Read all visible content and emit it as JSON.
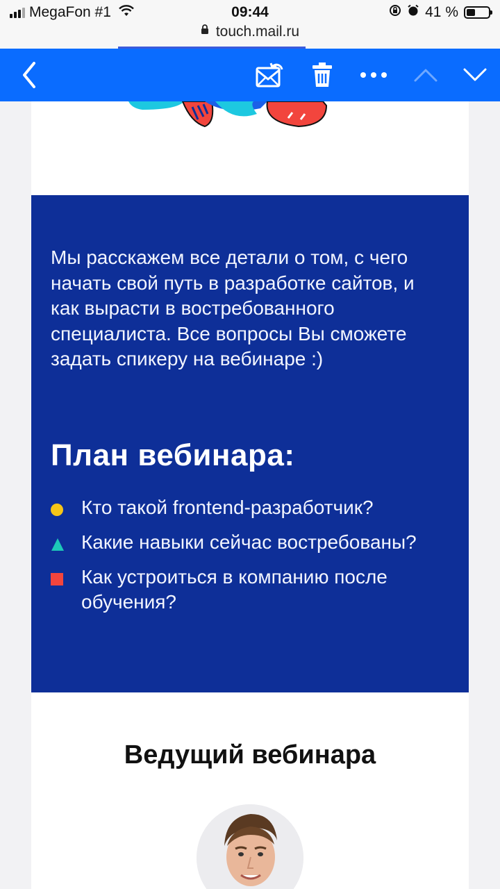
{
  "status_bar": {
    "carrier": "MegaFon #1",
    "time": "09:44",
    "battery": "41 %",
    "battery_level": 0.41,
    "url": "touch.mail.ru"
  },
  "toolbar": {
    "icons": [
      "back-chevron-icon",
      "move-mail-icon",
      "trash-icon",
      "more-dots-icon",
      "chevron-up-icon",
      "chevron-down-icon"
    ],
    "accent": "#0a6cff"
  },
  "email": {
    "intro": "Мы расскажем все детали о том, с чего начать свой путь в разработке сайтов, и как вырасти в востребованного специалиста. Все вопросы Вы сможете задать спикеру на вебинаре :)",
    "plan_title": "План вебинара:",
    "plan_items": [
      {
        "text": "Кто такой frontend-разработчик?",
        "bullet": "yellow-circle",
        "color": "#f5c518"
      },
      {
        "text": "Какие навыки сейчас востребованы?",
        "bullet": "teal-triangle",
        "color": "#1dc8b8"
      },
      {
        "text": "Как устроиться в компанию после обучения?",
        "bullet": "red-square",
        "color": "#f2453d"
      }
    ],
    "host_title": "Ведущий вебинара",
    "block_color": "#0e2f98"
  }
}
